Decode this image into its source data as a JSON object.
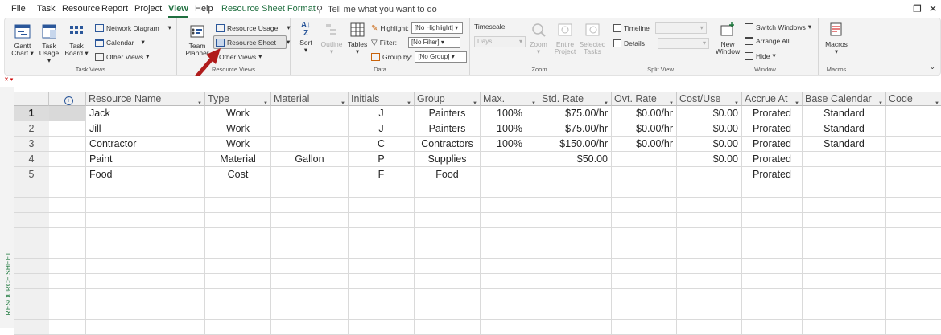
{
  "menu": {
    "items": [
      "File",
      "Task",
      "Resource",
      "Report",
      "Project",
      "View",
      "Help",
      "Resource Sheet Format"
    ],
    "active": "View",
    "tell_me": "Tell me what you want to do"
  },
  "ribbon": {
    "task_views": {
      "label": "Task Views",
      "gantt": "Gantt Chart",
      "usage": "Task Usage",
      "board": "Task Board",
      "network": "Network Diagram",
      "calendar": "Calendar",
      "other": "Other Views"
    },
    "resource_views": {
      "label": "Resource Views",
      "team": "Team Planner",
      "usage": "Resource Usage",
      "sheet": "Resource Sheet",
      "other": "Other Views"
    },
    "data": {
      "label": "Data",
      "sort": "Sort",
      "outline": "Outline",
      "tables": "Tables",
      "highlight_label": "Highlight:",
      "highlight_value": "[No Highlight]",
      "filter_label": "Filter:",
      "filter_value": "[No Filter]",
      "group_label": "Group by:",
      "group_value": "[No Group]"
    },
    "zoom": {
      "label": "Zoom",
      "timescale": "Timescale:",
      "timescale_value": "Days",
      "zoom": "Zoom",
      "entire": "Entire Project",
      "selected": "Selected Tasks"
    },
    "split": {
      "label": "Split View",
      "timeline": "Timeline",
      "details": "Details"
    },
    "window": {
      "label": "Window",
      "new": "New Window",
      "switch": "Switch Windows",
      "arrange": "Arrange All",
      "hide": "Hide"
    },
    "macros": {
      "label": "Macros",
      "macros": "Macros"
    }
  },
  "side_label": "RESOURCE SHEET",
  "table": {
    "columns": [
      "Resource Name",
      "Type",
      "Material",
      "Initials",
      "Group",
      "Max.",
      "Std. Rate",
      "Ovt. Rate",
      "Cost/Use",
      "Accrue At",
      "Base Calendar",
      "Code"
    ],
    "rows": [
      {
        "id": "1",
        "name": "Jack",
        "type": "Work",
        "material": "",
        "initials": "J",
        "group": "Painters",
        "max": "100%",
        "std": "$75.00/hr",
        "ovt": "$0.00/hr",
        "cost": "$0.00",
        "accrue": "Prorated",
        "base": "Standard",
        "code": ""
      },
      {
        "id": "2",
        "name": "Jill",
        "type": "Work",
        "material": "",
        "initials": "J",
        "group": "Painters",
        "max": "100%",
        "std": "$75.00/hr",
        "ovt": "$0.00/hr",
        "cost": "$0.00",
        "accrue": "Prorated",
        "base": "Standard",
        "code": ""
      },
      {
        "id": "3",
        "name": "Contractor",
        "type": "Work",
        "material": "",
        "initials": "C",
        "group": "Contractors",
        "max": "100%",
        "std": "$150.00/hr",
        "ovt": "$0.00/hr",
        "cost": "$0.00",
        "accrue": "Prorated",
        "base": "Standard",
        "code": ""
      },
      {
        "id": "4",
        "name": "Paint",
        "type": "Material",
        "material": "Gallon",
        "initials": "P",
        "group": "Supplies",
        "max": "",
        "std": "$50.00",
        "ovt": "",
        "cost": "$0.00",
        "accrue": "Prorated",
        "base": "",
        "code": ""
      },
      {
        "id": "5",
        "name": "Food",
        "type": "Cost",
        "material": "",
        "initials": "F",
        "group": "Food",
        "max": "",
        "std": "",
        "ovt": "",
        "cost": "",
        "accrue": "Prorated",
        "base": "",
        "code": ""
      }
    ]
  },
  "colors": {
    "accent": "#1f6f3f",
    "arrow": "#b01c1c"
  }
}
